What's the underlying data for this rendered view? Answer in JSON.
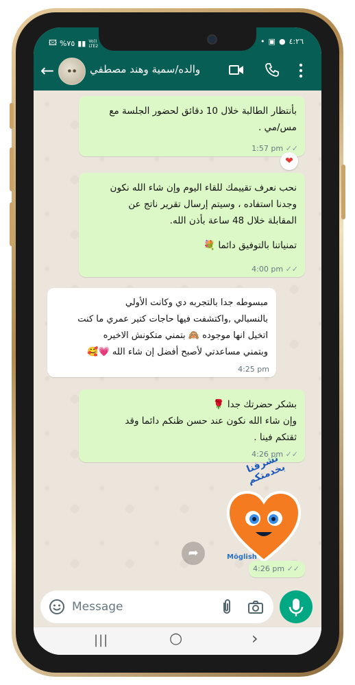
{
  "status_bar": {
    "left_text": "%٧٥",
    "carrier_text": "Vo)) LTE2",
    "time": "٤:٢٦"
  },
  "header": {
    "contact_name": "والده/سمية وهند مصطفي",
    "icons": [
      "back-arrow-icon",
      "video-call-icon",
      "phone-call-icon",
      "more-options-icon"
    ]
  },
  "messages": [
    {
      "direction": "outgoing",
      "lines": [
        "بأنتظار الطالبة خلال 10 دقائق لحضور الجلسة مع",
        "مس/مي ."
      ],
      "time": "1:57 pm",
      "ticks": "✓✓",
      "reaction": "❤"
    },
    {
      "direction": "outgoing",
      "lines": [
        "نحب نعرف تقييمك للقاء اليوم وإن شاء الله نكون",
        "وجدنا استفاده ، وسيتم إرسال تقرير ناتج عن",
        "المقابلة خلال 48 ساعة بأذن الله.",
        "",
        "تمنياتنا بالتوفيق دائما 💐"
      ],
      "time": "4:00 pm",
      "ticks": "✓✓"
    },
    {
      "direction": "incoming",
      "lines": [
        "مبسوطه جدا بالتجربه دي وكانت الأولي",
        "بالنسبالي ,واكتشفت فيها حاجات كتير عمري ما كنت",
        "اتخيل انها موجوده 🙈 بتمني متكونش الاخيره",
        "وبتمني مساعدتي لأصبح أفضل إن شاء الله 💗🥰"
      ],
      "time": "4:25 pm"
    },
    {
      "direction": "outgoing",
      "lines": [
        "بشكر حضرتك جدا 🌹",
        "وإن شاء الله نكون عند حسن ظنكم دائما وقد",
        "ثقتكم فينا ."
      ],
      "time": "4:26 pm",
      "ticks": "✓✓"
    },
    {
      "direction": "outgoing",
      "type": "sticker",
      "sticker_text": "تشرفنا بخدمتكم",
      "sticker_brand": "Möglish",
      "time": "4:26 pm",
      "ticks": "✓✓"
    }
  ],
  "input": {
    "placeholder": "Message"
  },
  "nav": {
    "recent": "|||",
    "home": "○",
    "back": "›"
  },
  "colors": {
    "header": "#075e54",
    "outgoing_bubble": "#dcf8c6",
    "incoming_bubble": "#ffffff",
    "mic_button": "#00a884",
    "chat_background": "#ece5dc"
  }
}
